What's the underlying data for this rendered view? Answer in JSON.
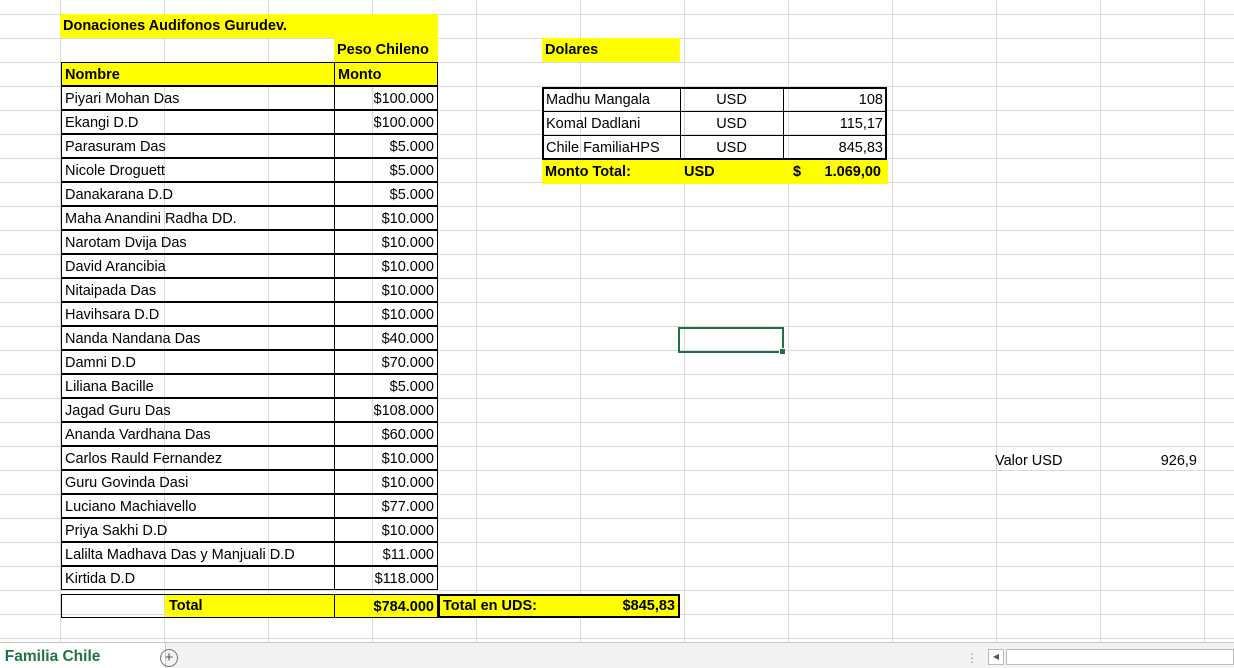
{
  "sheet": {
    "title": "Donaciones Audifonos Gurudev.",
    "currency_header": "Peso Chileno",
    "col_name_header": "Nombre",
    "col_amount_header": "Monto",
    "donors": [
      {
        "name": "Piyari Mohan Das",
        "amount": "$100.000"
      },
      {
        "name": "Ekangi D.D",
        "amount": "$100.000"
      },
      {
        "name": "Parasuram Das",
        "amount": "$5.000"
      },
      {
        "name": "Nicole Droguett",
        "amount": "$5.000"
      },
      {
        "name": "Danakarana D.D",
        "amount": "$5.000"
      },
      {
        "name": "Maha Anandini Radha DD.",
        "amount": "$10.000"
      },
      {
        "name": "Narotam Dvija Das",
        "amount": "$10.000"
      },
      {
        "name": "David Arancibia",
        "amount": "$10.000"
      },
      {
        "name": "Nitaipada Das",
        "amount": "$10.000"
      },
      {
        "name": "Havihsara D.D",
        "amount": "$10.000"
      },
      {
        "name": "Nanda Nandana Das",
        "amount": "$40.000"
      },
      {
        "name": "Damni D.D",
        "amount": "$70.000"
      },
      {
        "name": "Liliana Bacille",
        "amount": "$5.000"
      },
      {
        "name": "Jagad Guru Das",
        "amount": "$108.000"
      },
      {
        "name": "Ananda  Vardhana Das",
        "amount": "$60.000"
      },
      {
        "name": "Carlos Rauld Fernandez",
        "amount": "$10.000"
      },
      {
        "name": "Guru Govinda Dasi",
        "amount": "$10.000"
      },
      {
        "name": "Luciano Machiavello",
        "amount": "$77.000"
      },
      {
        "name": "Priya Sakhi D.D",
        "amount": "$10.000"
      },
      {
        "name": "Lalilta Madhava Das y Manjuali D.D",
        "amount": "$11.000"
      },
      {
        "name": "Kirtida D.D",
        "amount": "$118.000"
      }
    ],
    "total_label": "Total",
    "total_value": "$784.000",
    "total_uds_label": "Total en UDS:",
    "total_uds_value": "$845,83",
    "dolares_header": "Dolares",
    "usd_rows": [
      {
        "name": "Madhu Mangala",
        "currency": "USD",
        "amount": "108"
      },
      {
        "name": "Komal Dadlani",
        "currency": "USD",
        "amount": "115,17"
      },
      {
        "name": "Chile FamiliaHPS",
        "currency": "USD",
        "amount": "845,83"
      }
    ],
    "monto_total_label": "Monto Total:",
    "monto_total_currency": "USD",
    "monto_total_symbol": "$",
    "monto_total_value": "1.069,00",
    "valor_usd_label": "Valor USD",
    "valor_usd_value": "926,9"
  },
  "tabs": {
    "active_sheet": "n Familia Chile",
    "add_symbol": "+"
  },
  "colors": {
    "highlight": "#ffff00",
    "selection": "#1e7145",
    "tab_text": "#217346"
  }
}
